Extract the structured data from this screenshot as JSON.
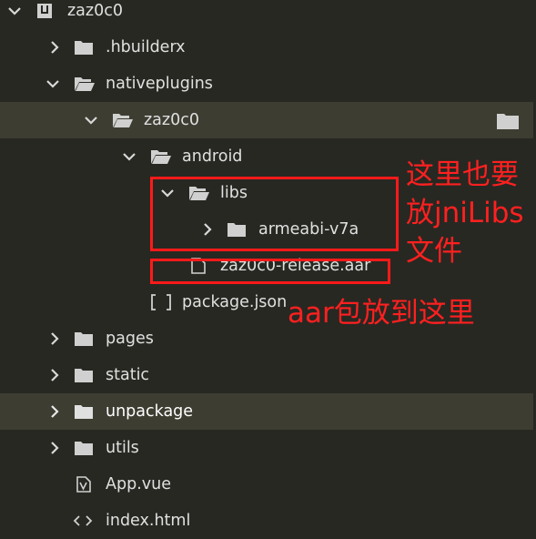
{
  "tree": {
    "rows": [
      {
        "label": "zaz0c0"
      },
      {
        "label": ".hbuilderx"
      },
      {
        "label": "nativeplugins"
      },
      {
        "label": "zaz0c0"
      },
      {
        "label": "android"
      },
      {
        "label": "libs"
      },
      {
        "label": "armeabi-v7a"
      },
      {
        "label": "zaz0c0-release.aar"
      },
      {
        "label": "package.json"
      },
      {
        "label": "pages"
      },
      {
        "label": "static"
      },
      {
        "label": "unpackage"
      },
      {
        "label": "utils"
      },
      {
        "label": "App.vue"
      },
      {
        "label": "index.html"
      }
    ]
  },
  "annotations": {
    "libs_note_line1": "这里也要",
    "libs_note_line2": "放jniLibs",
    "libs_note_line3": "文件",
    "aar_note": "aar包放到这里"
  },
  "icons": {
    "project": "project-icon",
    "folder": "folder-icon",
    "folder_open": "folder-open-icon",
    "file": "file-icon",
    "json": "json-icon",
    "vue": "vue-icon",
    "html": "html-icon",
    "chevron_right": "chevron-right-icon",
    "chevron_down": "chevron-down-icon"
  },
  "colors": {
    "background": "#272822",
    "highlight": "#3e3d32",
    "text": "#e0e0e0",
    "annotation": "#ff1a1a"
  }
}
